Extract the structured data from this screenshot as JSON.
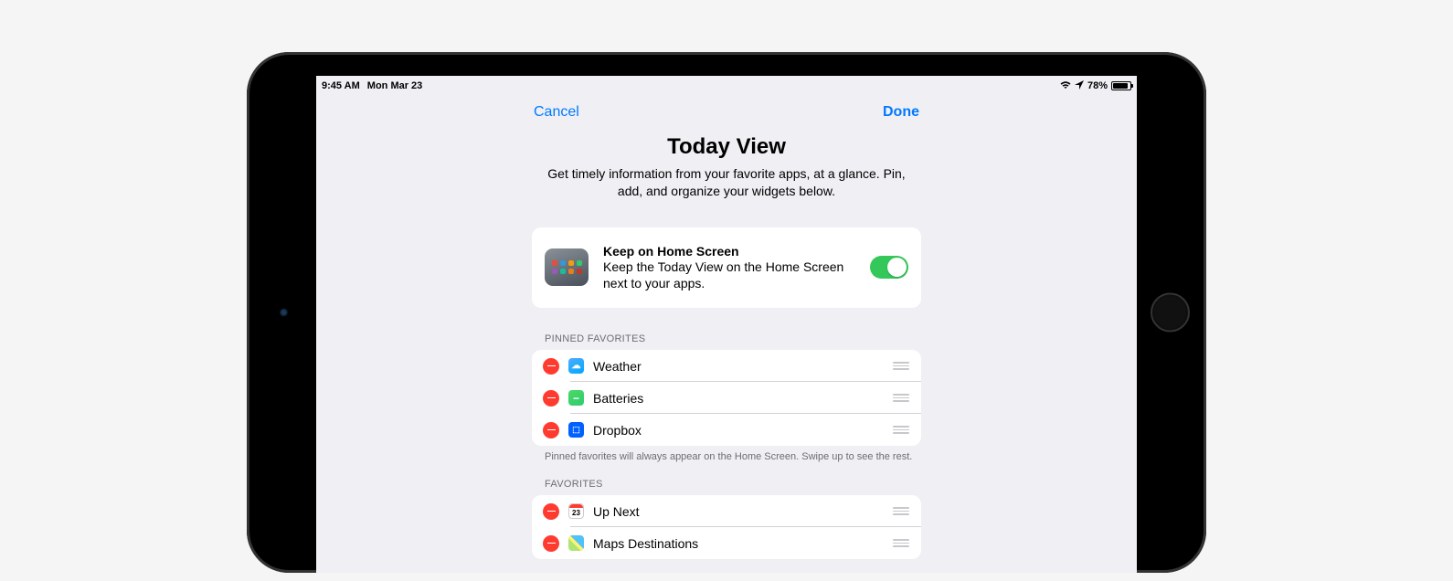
{
  "status": {
    "time": "9:45 AM",
    "date": "Mon Mar 23",
    "battery_pct": "78%"
  },
  "nav": {
    "cancel": "Cancel",
    "done": "Done"
  },
  "page": {
    "title": "Today View",
    "subtitle": "Get timely information from your favorite apps, at a glance. Pin, add, and organize your widgets below."
  },
  "keep_card": {
    "title": "Keep on Home Screen",
    "desc": "Keep the Today View on the Home Screen next to your apps.",
    "enabled": true
  },
  "pinned": {
    "header": "PINNED FAVORITES",
    "footer": "Pinned favorites will always appear on the Home Screen. Swipe up to see the rest.",
    "items": [
      {
        "label": "Weather"
      },
      {
        "label": "Batteries"
      },
      {
        "label": "Dropbox"
      }
    ]
  },
  "favorites": {
    "header": "FAVORITES",
    "items": [
      {
        "label": "Up Next",
        "cal_day": "23"
      },
      {
        "label": "Maps Destinations"
      }
    ]
  }
}
